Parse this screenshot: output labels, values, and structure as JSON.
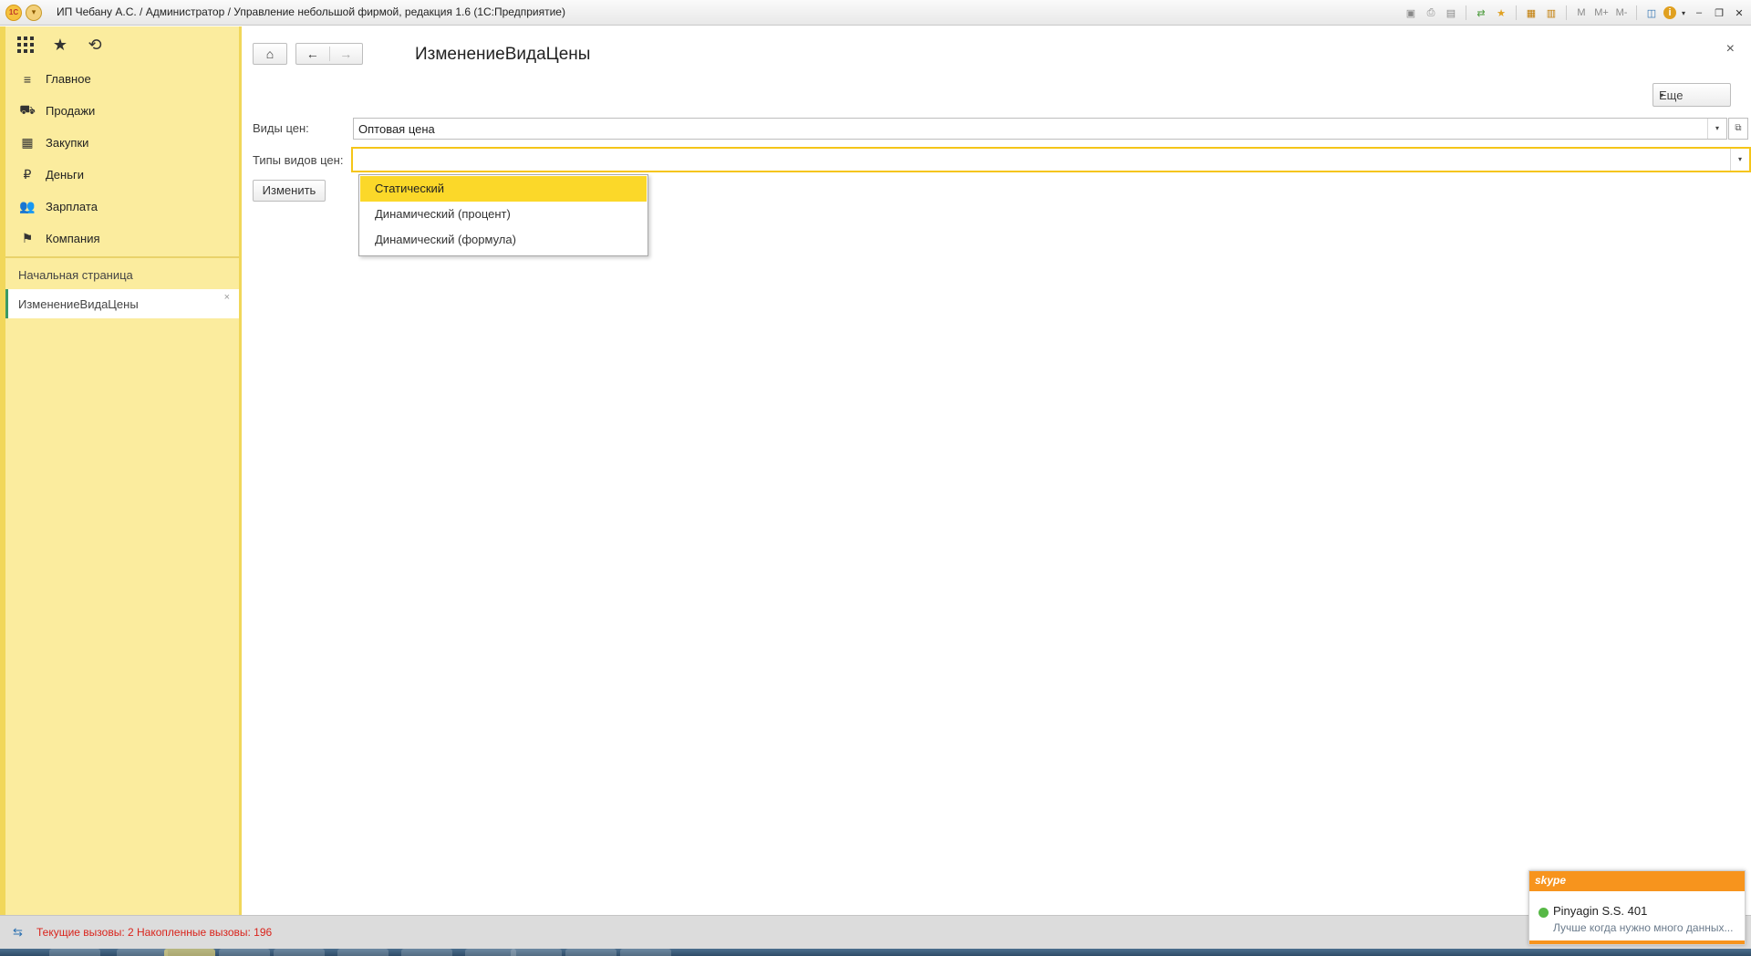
{
  "window": {
    "title": "ИП Чебану А.С. / Администратор / Управление небольшой фирмой, редакция 1.6  (1С:Предприятие)",
    "logo_text": "1C"
  },
  "titlebar_icons": [
    "save-icon",
    "print-icon",
    "preview-icon",
    "compare-icon",
    "bookmark-icon",
    "calculator-icon",
    "calendar-icon",
    "m-icon",
    "m-plus-icon",
    "m-minus-icon",
    "panels-icon",
    "info-icon",
    "minimize-icon",
    "restore-icon",
    "close-icon"
  ],
  "titlebar_glyphs": {
    "m": "M",
    "m_plus": "M+",
    "m_minus": "M-",
    "info": "i",
    "minimize": "–",
    "restore": "❐",
    "close": "✕"
  },
  "sidebar": {
    "items": [
      {
        "label": "Главное",
        "icon": "menu-lines-icon"
      },
      {
        "label": "Продажи",
        "icon": "basket-icon"
      },
      {
        "label": "Закупки",
        "icon": "grid-cart-icon"
      },
      {
        "label": "Деньги",
        "icon": "ruble-coin-icon"
      },
      {
        "label": "Зарплата",
        "icon": "people-icon"
      },
      {
        "label": "Компания",
        "icon": "flag-icon"
      }
    ],
    "open_windows": [
      {
        "label": "Начальная страница",
        "active": false
      },
      {
        "label": "ИзменениеВидаЦены",
        "active": true
      }
    ]
  },
  "form": {
    "title": "ИзменениеВидаЦены",
    "more_label": "Еще",
    "price_kinds_label": "Виды цен:",
    "price_kinds_value": "Оптовая цена",
    "price_types_label": "Типы видов цен:",
    "price_types_value": "",
    "change_button": "Изменить"
  },
  "dropdown": {
    "options": [
      "Статический",
      "Динамический (процент)",
      "Динамический (формула)"
    ],
    "selected_index": 0
  },
  "status": {
    "text": "Текущие вызовы: 2   Накопленные вызовы: 196"
  },
  "skype": {
    "brand": "skype",
    "contact": "Pinyagin S.S. 401",
    "message": "Лучше когда нужно много данных..."
  },
  "colors": {
    "sidebar_bg": "#fbec9e",
    "selected_option": "#fbd829",
    "focus_border": "#f5c518",
    "status_text": "#d9241c",
    "skype_orange": "#f7941d"
  }
}
